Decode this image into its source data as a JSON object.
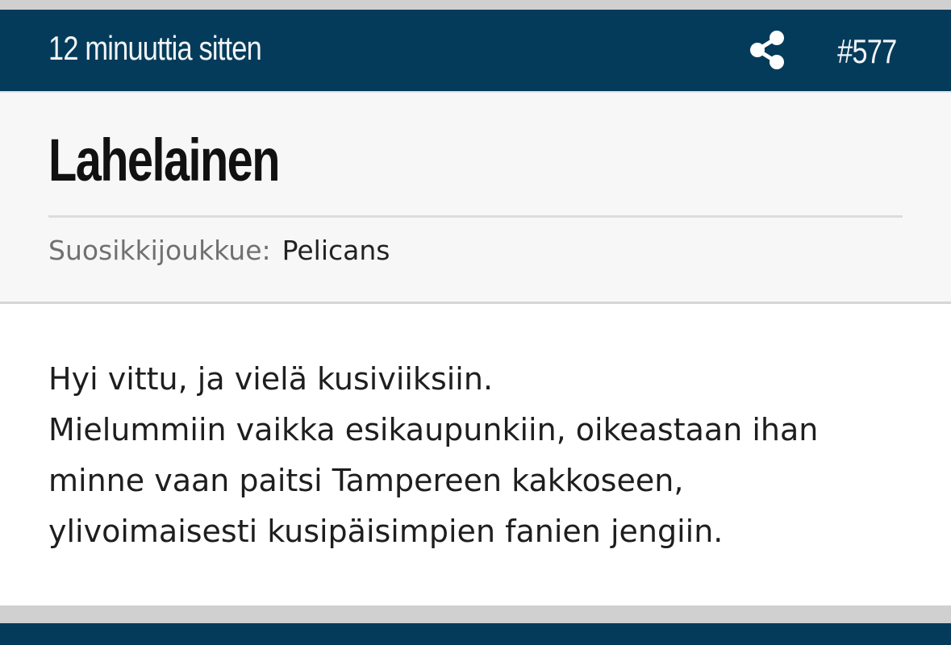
{
  "post": {
    "time_ago": "12 minuuttia sitten",
    "number": "#577",
    "share_icon": "share-icon",
    "username": "Lahelainen",
    "favorite_team_label": "Suosikkijoukkue:",
    "favorite_team_value": "Pelicans",
    "message_lines": [
      "Hyi vittu, ja vielä kusiviiksiin.",
      "Mielummiin vaikka esikaupunkiin, oikeastaan ihan",
      "minne vaan paitsi Tampereen kakkoseen,",
      "ylivoimaisesti kusipäisimpien fanien jengiin."
    ]
  },
  "colors": {
    "header_bg": "#043b5a",
    "panel_bg": "#f7f7f7",
    "page_bg": "#d0d0d0"
  }
}
